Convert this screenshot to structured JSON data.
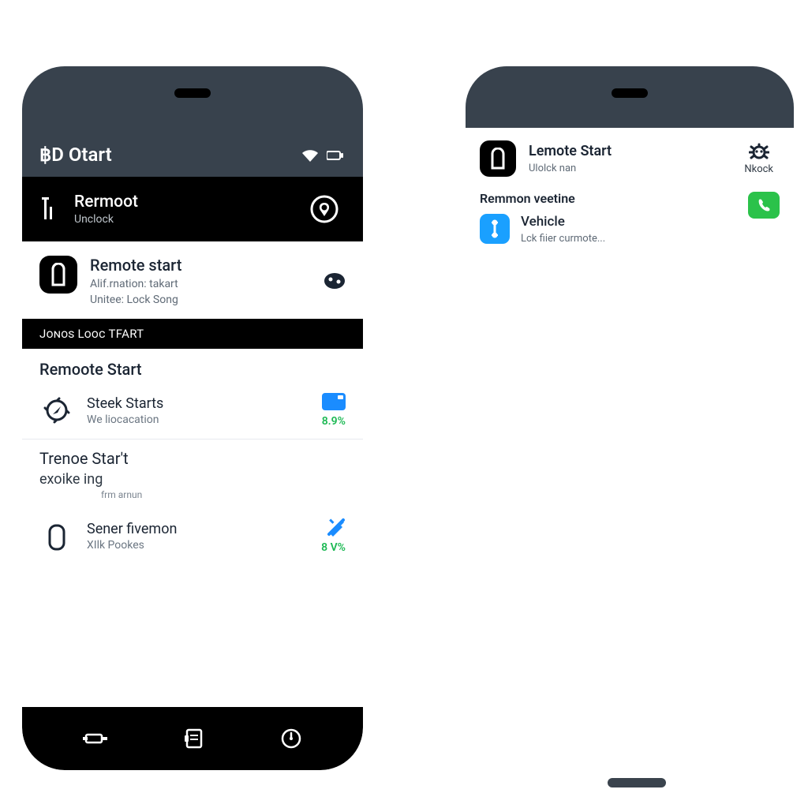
{
  "left": {
    "status_title": "฿D Otart",
    "sub": {
      "title": "Rermoot",
      "subtitle": "Unclock"
    },
    "row1": {
      "title": "Remote start",
      "line1": "Alif.rnation: takart",
      "line2": "Unitee:  Lock Song"
    },
    "band": "Jonos Looc TFART",
    "h2": "Remoote Start",
    "row2": {
      "title": "Steek Starts",
      "subtitle": "We liocacation",
      "stat": "8.9%"
    },
    "sec3": {
      "title": "Trenoe Star't",
      "subtitle": "exoike ing",
      "subsub": "frm arnun"
    },
    "row4": {
      "title": "Sener fivemon",
      "subtitle": "XIlk Pookes",
      "stat": "8 V%"
    }
  },
  "right": {
    "row1": {
      "title": "Lemote Start",
      "subtitle": "Ulolck nan",
      "right_label": "Nkock"
    },
    "h2": "Remmon veetine",
    "row2": {
      "title": "Vehicle",
      "subtitle": "Lck fiier curmote..."
    }
  }
}
